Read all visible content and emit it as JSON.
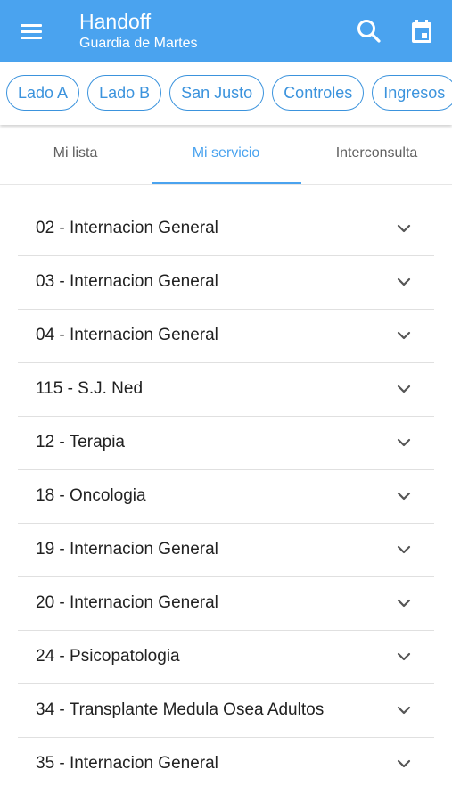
{
  "app_bar": {
    "title": "Handoff",
    "subtitle": "Guardia de Martes",
    "color": "#4aa3ef",
    "icons": [
      "menu-icon",
      "search-icon",
      "calendar-icon"
    ]
  },
  "chips": [
    "Lado A",
    "Lado B",
    "San Justo",
    "Controles",
    "Ingresos"
  ],
  "tabs": [
    {
      "label": "Mi lista",
      "active": false
    },
    {
      "label": "Mi servicio",
      "active": true
    },
    {
      "label": "Interconsulta",
      "active": false
    }
  ],
  "services": [
    "02 - Internacion General",
    "03 - Internacion General",
    "04 - Internacion General",
    "115 - S.J. Ned",
    "12 - Terapia",
    "18 - Oncologia",
    "19 - Internacion General",
    "20 - Internacion General",
    "24 - Psicopatologia",
    "34 - Transplante Medula Osea Adultos",
    "35 - Internacion General"
  ]
}
